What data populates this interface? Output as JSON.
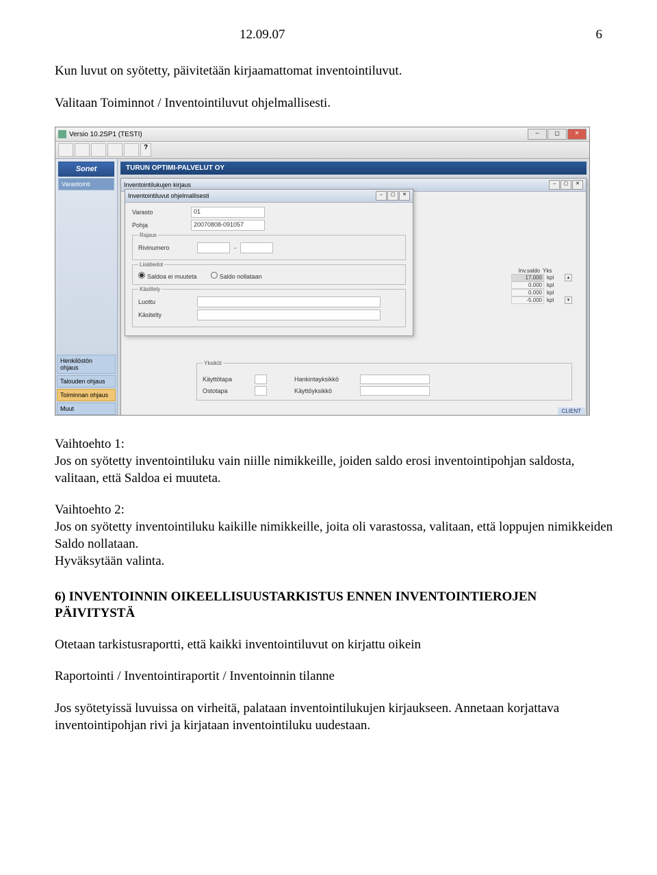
{
  "header": {
    "date": "12.09.07",
    "page": "6"
  },
  "intro": {
    "p1": "Kun luvut on syötetty, päivitetään kirjaamattomat inventointiluvut.",
    "p2": "Valitaan Toiminnot / Inventointiluvut ohjelmallisesti."
  },
  "app": {
    "version_title": "Versio 10.2SP1 (TESTI)",
    "logo": "Sonet",
    "sidebar_top": "Varastointi",
    "sidebar_items": [
      "Henkilöstön ohjaus",
      "Talouden ohjaus",
      "Toiminnan ohjaus",
      "Muut"
    ],
    "company": "TURUN OPTIMI-PALVELUT OY",
    "mdi_outer_title": "Inventointilukujen kirjaus",
    "mdi_inner_title": "Inventointiluvut ohjelmallisesti",
    "form": {
      "varasto_label": "Varasto",
      "varasto_value": "01",
      "pohja_label": "Pohja",
      "pohja_value": "20070808-091057",
      "rajaus_legend": "Rajaus",
      "rivinumero_label": "Rivinumero",
      "rivinumero_sep": "-",
      "lisatiedot_legend": "Lisätiedot",
      "radio1": "Saldoa ei muuteta",
      "radio2": "Saldo nollataan",
      "kasittely_legend": "Käsittely",
      "luottu_label": "Luottu",
      "kasitelty_label": "Käsitelty"
    },
    "inv_table": {
      "header1": "Inv.saldo",
      "header2": "Yks",
      "rows": [
        {
          "val": "17.000",
          "unit": "kpl"
        },
        {
          "val": "0.000",
          "unit": "kpl"
        },
        {
          "val": "0.000",
          "unit": "kpl"
        },
        {
          "val": "-5.000",
          "unit": "kpl"
        }
      ]
    },
    "bottom": {
      "yksikot_legend": "Yksiköt",
      "kayttotapa": "Käyttötapa",
      "ostotapa": "Ostotapa",
      "hankintayksikko": "Hankintayksikkö",
      "kayttoyksikko": "Käyttöyksikkö"
    },
    "client": "CLIENT"
  },
  "body": {
    "v1_title": "Vaihtoehto 1:",
    "v1_text": "Jos on syötetty inventointiluku vain niille nimikkeille, joiden saldo erosi inventointipohjan saldosta, valitaan, että Saldoa ei muuteta.",
    "v2_title": "Vaihtoehto 2:",
    "v2_text": "Jos on syötetty inventointiluku  kaikille nimikkeille, joita oli varastossa, valitaan, että loppujen nimikkeiden Saldo nollataan.",
    "v2_extra": "Hyväksytään valinta.",
    "heading": "6) INVENTOINNIN OIKEELLISUUSTARKISTUS ENNEN INVENTOINTIEROJEN PÄIVITYSTÄ",
    "p3": "Otetaan tarkistusraportti, että kaikki inventointiluvut on kirjattu oikein",
    "p4": "Raportointi / Inventointiraportit / Inventoinnin tilanne",
    "p5": "Jos syötetyissä luvuissa on virheitä, palataan inventointilukujen kirjaukseen. Annetaan korjattava inventointipohjan rivi ja kirjataan inventointiluku uudestaan."
  }
}
